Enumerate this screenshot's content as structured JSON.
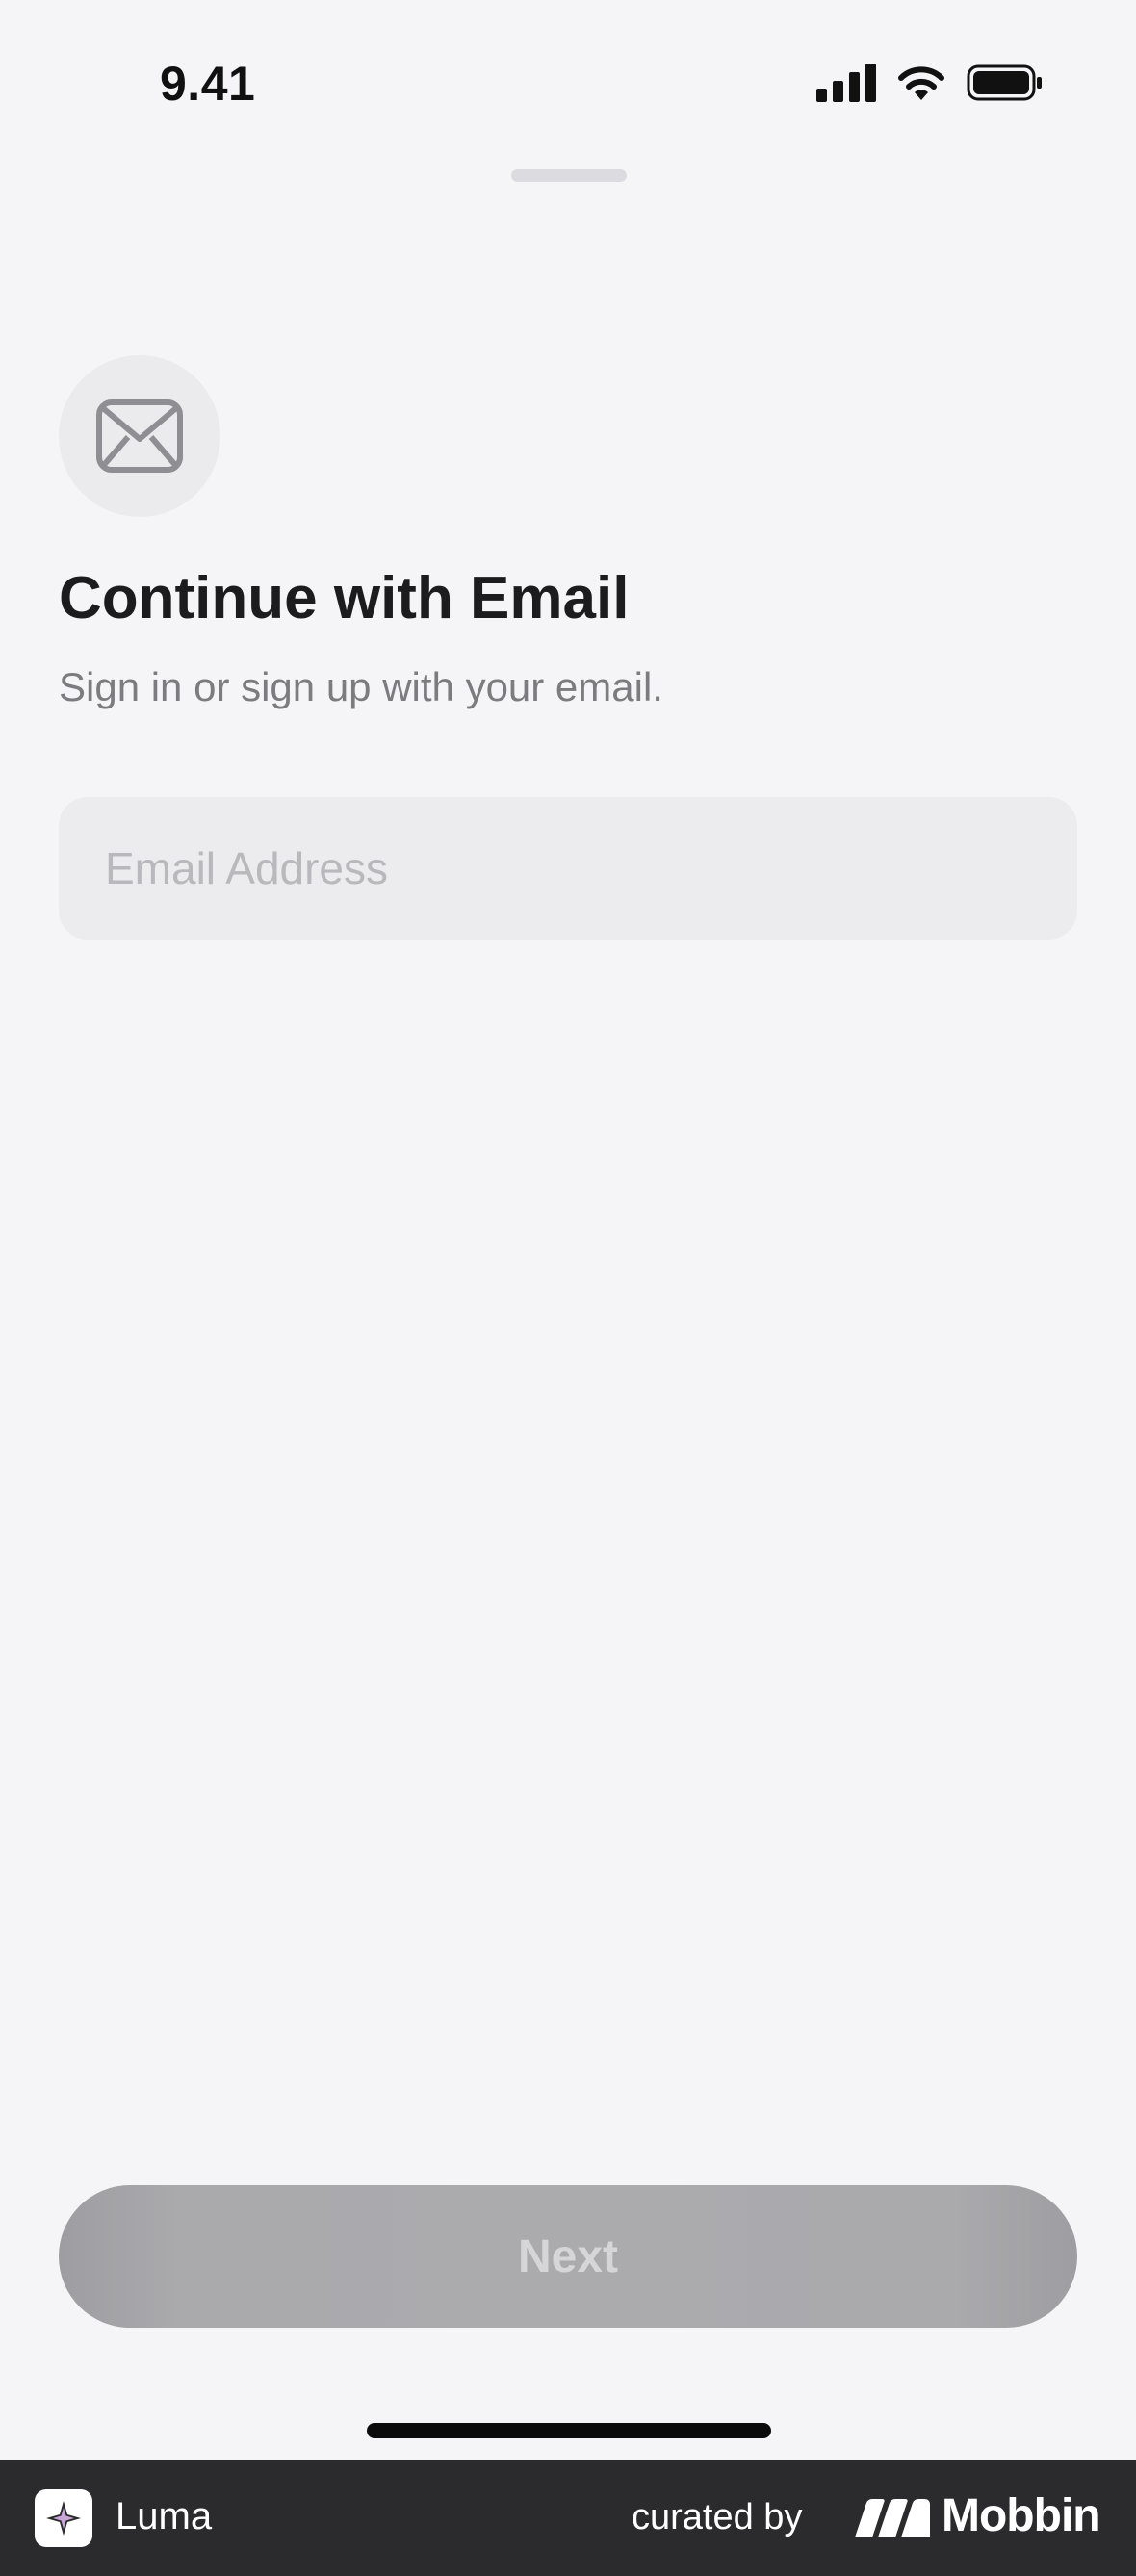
{
  "status_bar": {
    "time": "9.41",
    "icons": [
      "cellular-signal-icon",
      "wifi-icon",
      "battery-icon"
    ]
  },
  "sheet": {
    "icon": "mail-icon",
    "title": "Continue with Email",
    "subtitle": "Sign in or sign up with your email.",
    "email_field": {
      "value": "",
      "placeholder": "Email Address"
    },
    "next_label": "Next"
  },
  "footer": {
    "app_name": "Luma",
    "curated_by": "curated by",
    "brand": "Mobbin"
  },
  "colors": {
    "background": "#f5f5f7",
    "button_disabled": "#ababae",
    "footer": "#2b2b2d"
  }
}
